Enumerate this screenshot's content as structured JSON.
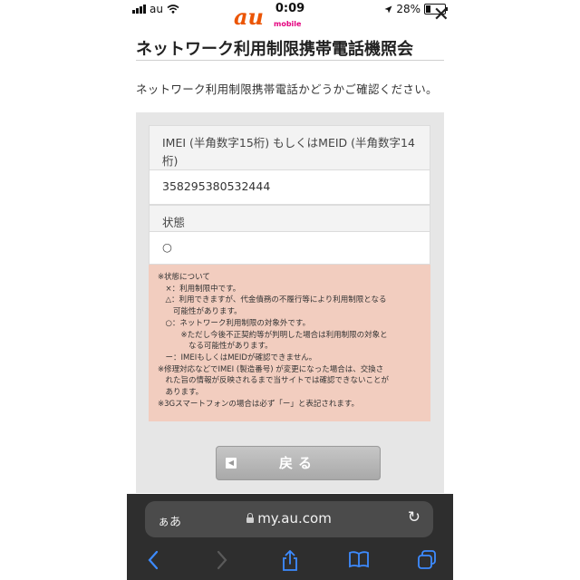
{
  "status_bar": {
    "carrier": "au",
    "time": "0:09",
    "battery": "28%",
    "battery_level": 0.28
  },
  "header": {
    "logo_text": "au",
    "logo_sub": "mobile",
    "close_glyph": "✕"
  },
  "page": {
    "title": "ネットワーク利用制限携帯電話機照会",
    "lead": "ネットワーク利用制限携帯電話かどうかご確認ください。"
  },
  "result": {
    "imei_label_line1": "IMEI (半角数字15桁) もしくはMEID (半角数字14",
    "imei_label_line2": "桁)",
    "imei_value": "358295380532444",
    "state_label": "状態",
    "state_value": "○"
  },
  "notes": [
    "※状態について",
    "　×：利用制限中です。",
    "　△：利用できますが、代金債務の不履行等により利用制限となる",
    "　　可能性があります。",
    "　○：ネットワーク利用制限の対象外です。",
    "　　　※ただし今後不正契約等が判明した場合は利用制限の対象と",
    "　　　　なる可能性があります。",
    "　ー：IMEIもしくはMEIDが確認できません。",
    "※修理対応などでIMEI (製造番号) が変更になった場合は、交換さ",
    "　れた旨の情報が反映されるまで当サイトでは確認できないことが",
    "　あります。",
    "※3Gスマートフォンの場合は必ず「ー」と表記されます。"
  ],
  "back_button": {
    "label": "戻る"
  },
  "safari": {
    "aa": "ぁあ",
    "domain": "my.au.com"
  }
}
